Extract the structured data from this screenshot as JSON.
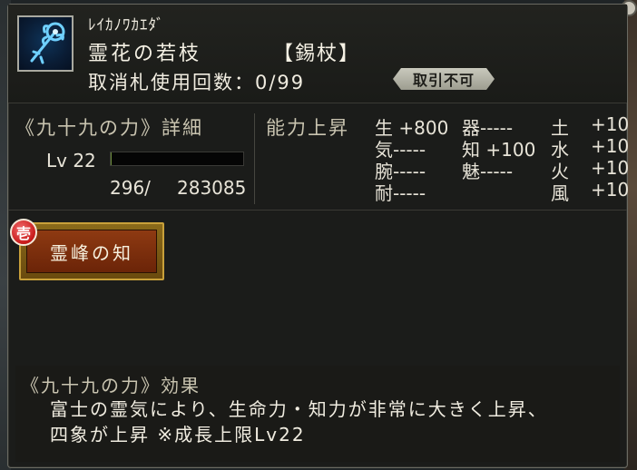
{
  "item": {
    "kana": "ﾚｲｶﾉﾜｶｴﾀﾞ",
    "name": "霊花の若枝",
    "type": "【錫杖】",
    "icon": "staff-icon",
    "cancel_label": "取消札使用回数：0/99",
    "trade_status": "取引不可"
  },
  "power": {
    "title": "《九十九の力》詳細",
    "lv_label": "Lv 22",
    "exp_current": "296/",
    "exp_max": "283085",
    "exp_fraction": 0.001
  },
  "ability": {
    "title": "能力上昇",
    "stats": [
      {
        "text": "生 +800"
      },
      {
        "text": "気-----"
      },
      {
        "text": "腕-----"
      },
      {
        "text": "耐-----"
      },
      {
        "text": "器-----"
      },
      {
        "text": "知 +100"
      },
      {
        "text": "魅-----"
      },
      {
        "text": "土"
      },
      {
        "text": "水"
      },
      {
        "text": "火"
      },
      {
        "text": "風"
      },
      {
        "text": "+10"
      },
      {
        "text": "+10"
      },
      {
        "text": "+10"
      },
      {
        "text": "+10"
      }
    ]
  },
  "skill": {
    "seal": "壱",
    "name": "霊峰の知"
  },
  "effect": {
    "title": "《九十九の力》効果",
    "line1": "富士の霊気により、生命力・知力が非常に大きく上昇、",
    "line2": "四象が上昇 ※成長上限Lv22"
  },
  "colors": {
    "skill_border": "#c8a03a",
    "skill_inner": "#8e3a12",
    "seal_red": "#c81a1a"
  }
}
